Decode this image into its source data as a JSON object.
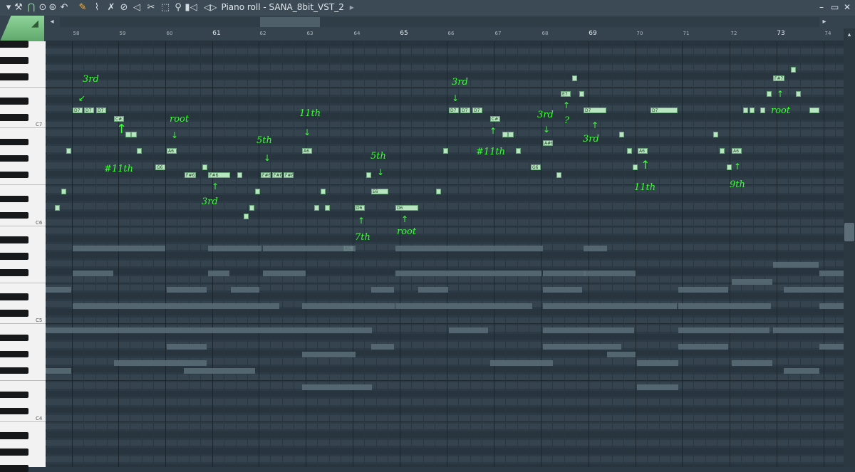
{
  "window": {
    "title": "Piano roll - SANA_8bit_VST_2",
    "title_arrow": "▸",
    "controls": [
      "–",
      "▭",
      "✕"
    ],
    "accent": "#8fd49a"
  },
  "toolbar": {
    "icons": [
      "wrench-icon",
      "magnet-icon",
      "loop-icon",
      "play-icon",
      "undo-icon",
      "pencil-icon",
      "brush-icon",
      "erase-icon",
      "delete-icon",
      "mute-icon",
      "slice-icon",
      "select-icon",
      "zoom-icon",
      "playback-icon"
    ],
    "glyphs": [
      "⚒",
      "⋂",
      "⊙",
      "⊜",
      "↶",
      "✎",
      "⌇",
      "✗",
      "⊘",
      "◁",
      "✂",
      "⬚",
      "⚲",
      "▮◁"
    ]
  },
  "ruler": {
    "bars": [
      "58",
      "59",
      "60",
      "61",
      "62",
      "63",
      "64",
      "65",
      "66",
      "67",
      "68",
      "69",
      "70",
      "71",
      "72",
      "73",
      "74"
    ],
    "major": [
      "61",
      "65",
      "69",
      "73"
    ]
  },
  "keyboard": {
    "octave_labels": [
      "C7",
      "C6",
      "C5",
      "C4"
    ]
  },
  "notes": [
    {
      "label": "D7"
    },
    {
      "label": "D7"
    },
    {
      "label": "D7"
    },
    {
      "label": "C#7"
    },
    {
      "label": ""
    },
    {
      "label": ""
    },
    {
      "label": ""
    },
    {
      "label": "A6"
    },
    {
      "label": "G6"
    },
    {
      "label": "F#6"
    },
    {
      "label": ""
    },
    {
      "label": "F#6"
    },
    {
      "label": "F#6"
    },
    {
      "label": "F#6"
    },
    {
      "label": "F#6"
    },
    {
      "label": "A6"
    },
    {
      "label": "E6"
    },
    {
      "label": "D6"
    },
    {
      "label": "A5"
    },
    {
      "label": "D6"
    },
    {
      "label": "D7"
    },
    {
      "label": "D7"
    },
    {
      "label": "D7"
    },
    {
      "label": "C#7"
    },
    {
      "label": ""
    },
    {
      "label": ""
    },
    {
      "label": "E7"
    },
    {
      "label": "A#6"
    },
    {
      "label": "G6"
    },
    {
      "label": "D7"
    },
    {
      "label": "D7"
    },
    {
      "label": "A6"
    },
    {
      "label": "A6"
    },
    {
      "label": "F#7"
    },
    {
      "label": ""
    },
    {
      "label": ""
    },
    {
      "label": ""
    },
    {
      "label": ""
    },
    {
      "label": ""
    },
    {
      "label": ""
    },
    {
      "label": ""
    },
    {
      "label": ""
    },
    {
      "label": ""
    },
    {
      "label": ""
    },
    {
      "label": ""
    },
    {
      "label": ""
    },
    {
      "label": ""
    },
    {
      "label": ""
    },
    {
      "label": ""
    },
    {
      "label": ""
    },
    {
      "label": ""
    },
    {
      "label": ""
    },
    {
      "label": ""
    },
    {
      "label": ""
    },
    {
      "label": ""
    },
    {
      "label": ""
    },
    {
      "label": ""
    },
    {
      "label": ""
    },
    {
      "label": ""
    },
    {
      "label": ""
    },
    {
      "label": ""
    },
    {
      "label": ""
    },
    {
      "label": ""
    },
    {
      "label": ""
    }
  ],
  "annotations": {
    "a_3rd_1": "3rd",
    "a_sharp11_1": "#11th",
    "a_root_1": "root",
    "a_3rd_2": "3rd",
    "a_5th_1": "5th",
    "a_11th_1": "11th",
    "a_5th_2": "5th",
    "a_7th": "7th",
    "a_root_2": "root",
    "a_3rd_3": "3rd",
    "a_sharp11_2": "#11th",
    "a_3rd_4": "3rd",
    "a_q": "?",
    "a_3rd_5": "3rd",
    "a_11th_2": "11th",
    "a_9th": "9th",
    "a_root_3": "root"
  },
  "colors": {
    "note": "#b7e6c0",
    "ghost": "#5a6d78",
    "annotation": "#3cff35",
    "grid_bg": "#2c3a45"
  }
}
